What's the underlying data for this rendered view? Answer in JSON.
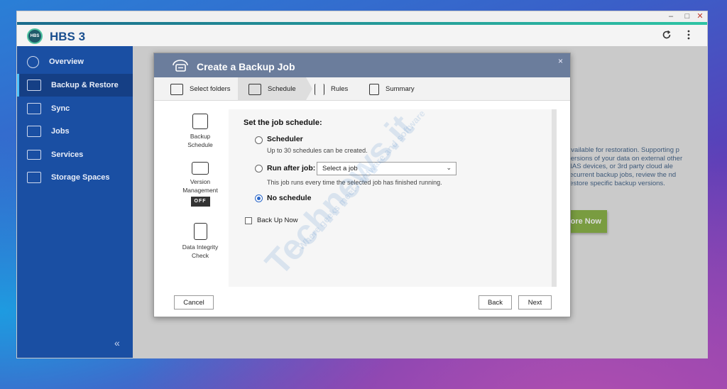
{
  "window": {
    "controls": [
      "–",
      "□",
      "✕"
    ]
  },
  "header": {
    "app_title": "HBS 3",
    "logo_text": "HBS",
    "refresh_icon": "refresh-icon",
    "more_icon": "more-vertical-icon"
  },
  "sidebar": {
    "items": [
      {
        "label": "Overview",
        "icon": "gauge-icon"
      },
      {
        "label": "Backup & Restore",
        "icon": "backup-restore-icon",
        "active": true
      },
      {
        "label": "Sync",
        "icon": "sync-icon"
      },
      {
        "label": "Jobs",
        "icon": "jobs-icon"
      },
      {
        "label": "Services",
        "icon": "services-icon"
      },
      {
        "label": "Storage Spaces",
        "icon": "storage-icon"
      }
    ],
    "collapse_label": "«"
  },
  "background": {
    "description": "available for restoration. Supporting p versions of your data on external other NAS devices, or 3rd party cloud ale recurrent backup jobs, review the nd restore specific backup versions.",
    "button_label": "ore Now"
  },
  "dialog": {
    "title": "Create a Backup Job",
    "close_label": "×",
    "steps": [
      {
        "label": "Select folders",
        "icon": "folder-icon"
      },
      {
        "label": "Schedule",
        "icon": "calendar-icon",
        "active": true
      },
      {
        "label": "Rules",
        "icon": "sliders-icon"
      },
      {
        "label": "Summary",
        "icon": "clipboard-icon"
      }
    ],
    "left_nav": {
      "backup_schedule": "Backup Schedule",
      "version_management": "Version Management",
      "version_badge": "OFF",
      "data_integrity": "Data Integrity Check"
    },
    "section_title": "Set the job schedule:",
    "options": {
      "scheduler": {
        "label": "Scheduler",
        "desc": "Up to 30 schedules can be created.",
        "selected": false
      },
      "run_after": {
        "label": "Run after job:",
        "desc": "This job runs every time the selected job has finished running.",
        "selected": false
      },
      "no_schedule": {
        "label": "No schedule",
        "selected": true
      }
    },
    "select": {
      "value": "Select a job"
    },
    "backup_now": {
      "label": "Back Up Now",
      "checked": false
    },
    "buttons": {
      "cancel": "Cancel",
      "back": "Back",
      "next": "Next"
    }
  },
  "watermark": {
    "big": "Technews.it",
    "small": "Where geeks meet hardware and software"
  },
  "colors": {
    "sidebar": "#1a4fa3",
    "dialog_header": "#6b7d9c",
    "accent": "#2a67c9",
    "learn_button": "#7aa82e"
  }
}
